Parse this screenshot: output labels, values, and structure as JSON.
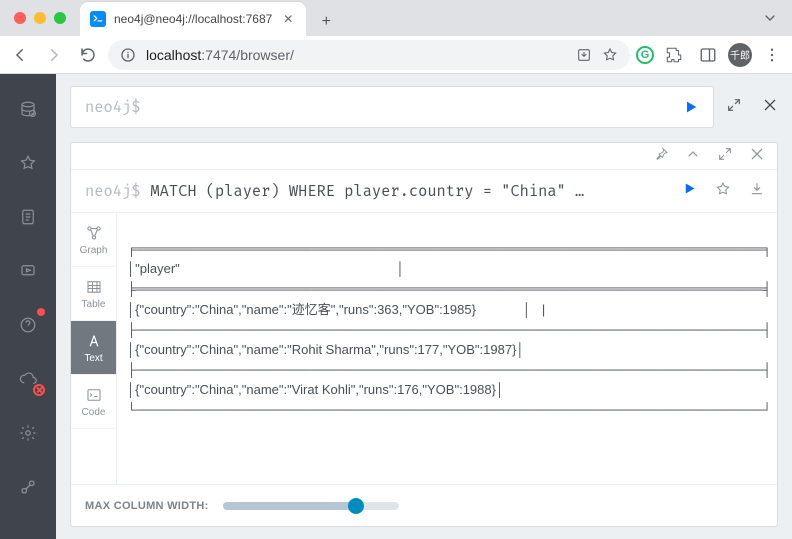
{
  "browser": {
    "tab_title": "neo4j@neo4j://localhost:7687",
    "url_host": "localhost",
    "url_rest": ":7474/browser/",
    "avatar_label": "千郎"
  },
  "editor": {
    "prompt": "neo4j$"
  },
  "result": {
    "prompt": "neo4j$",
    "query": "MATCH (player) WHERE player.country = \"China\" …"
  },
  "views": {
    "graph": "Graph",
    "table": "Table",
    "text": "Text",
    "code": "Code"
  },
  "ascii": {
    "top": "╒════════════════════════════════════════════════════════════════════╕",
    "hdr": "│\"player\"                                                            │",
    "mid": "╞════════════════════════════════════════════════════════════════════╡",
    "r1": "│{\"country\":\"China\",\"name\":\"迹忆客\",\"runs\":363,\"YOB\":1985}             │",
    "sep": "├────────────────────────────────────────────────────────────────────┤",
    "r2": "│{\"country\":\"China\",\"name\":\"Rohit Sharma\",\"runs\":177,\"YOB\":1987}│",
    "r3": "│{\"country\":\"China\",\"name\":\"Virat Kohli\",\"runs\":176,\"YOB\":1988}│",
    "bot": "└────────────────────────────────────────────────────────────────────┘",
    "cursor": "|"
  },
  "footer": {
    "max_col": "MAX COLUMN WIDTH:"
  }
}
